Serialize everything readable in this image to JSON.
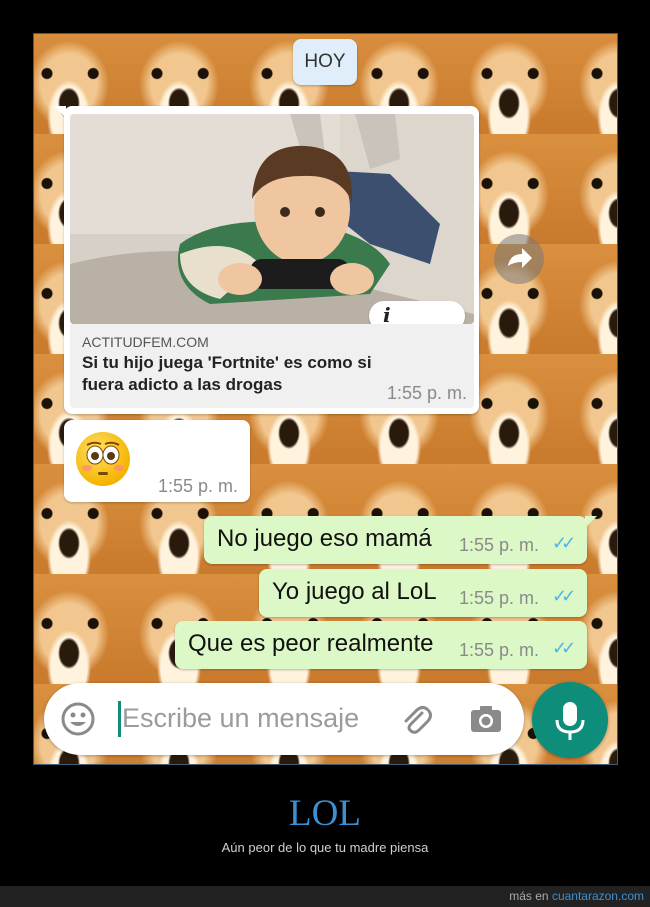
{
  "chat": {
    "date_label": "HOY",
    "link_message": {
      "site": "ACTITUDFEM.COM",
      "title": "Si tu hijo juega 'Fortnite' es como si fuera adicto a las drogas",
      "info_icon": "i",
      "time": "1:55 p. m."
    },
    "emoji_message": {
      "emoji": "flushed-face",
      "time": "1:55 p. m."
    },
    "outgoing": [
      {
        "text": "No juego eso mamá",
        "time": "1:55 p. m."
      },
      {
        "text": "Yo juego al LoL",
        "time": "1:55 p. m."
      },
      {
        "text": "Que es peor realmente",
        "time": "1:55 p. m."
      }
    ],
    "tick_color": "#4fb4e9",
    "accent": "#0e8d7a"
  },
  "input": {
    "placeholder": "Escribe un mensaje",
    "icons": [
      "emoji-icon",
      "attach-icon",
      "camera-icon",
      "mic-icon"
    ]
  },
  "caption": {
    "title": "LOL",
    "subtitle": "Aún peor de lo que tu madre piensa"
  },
  "footer": {
    "prefix": "más en",
    "site": "cuantarazon.com"
  }
}
